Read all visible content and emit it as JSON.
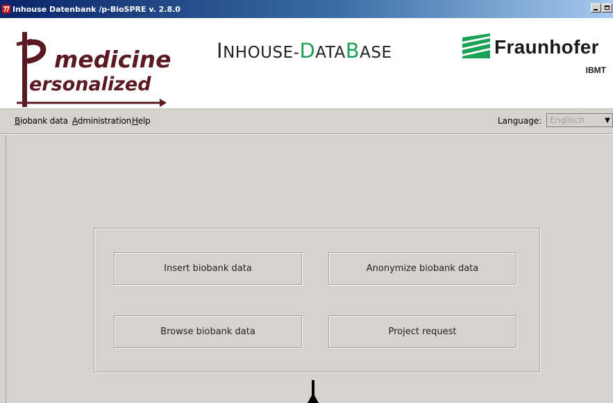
{
  "window": {
    "title": "Inhouse Datenbank /p-BioSPRE v. 2.8.0",
    "icon": "biospre-app-icon"
  },
  "header": {
    "logo_left": {
      "word1": "medicine",
      "word2": "ersonalized",
      "color": "#5b1a22"
    },
    "db_title": {
      "p1": "I",
      "p2": "NHOUSE-",
      "p3": "D",
      "p4": "ATA",
      "p5": "B",
      "p6": "ASE",
      "accent_color": "#1ba155"
    },
    "logo_right": {
      "name": "Fraunhofer",
      "sub": "IBMT",
      "accent_color": "#1ba155"
    }
  },
  "menu": {
    "items": [
      {
        "u": "B",
        "rest": "iobank data"
      },
      {
        "u": "A",
        "rest": "dministration"
      },
      {
        "u": "H",
        "rest": "elp"
      }
    ],
    "language_label": "Language:",
    "language_value": "Englisch"
  },
  "actions": {
    "insert": "Insert biobank data",
    "anonymize": "Anonymize biobank data",
    "browse": "Browse biobank data",
    "project": "Project request"
  }
}
